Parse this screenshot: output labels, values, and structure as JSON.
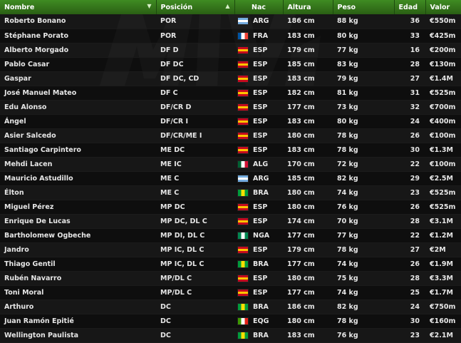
{
  "headers": {
    "name": "Nombre",
    "position": "Posición",
    "nation": "Nac",
    "height": "Altura",
    "weight": "Peso",
    "age": "Edad",
    "value": "Valor"
  },
  "flag_colors": {
    "ARG": [
      "#74acdf",
      "#ffffff",
      "#74acdf"
    ],
    "FRA": [
      "#0055a4",
      "#ffffff",
      "#ef4135"
    ],
    "ESP": [
      "#c60b1e",
      "#ffc400",
      "#c60b1e"
    ],
    "ALG": [
      "#006233",
      "#ffffff",
      "#d21034"
    ],
    "BRA": [
      "#009c3b",
      "#ffdf00",
      "#009c3b"
    ],
    "NGA": [
      "#008751",
      "#ffffff",
      "#008751"
    ],
    "EQG": [
      "#3e9a00",
      "#ffffff",
      "#e32118"
    ]
  },
  "players": [
    {
      "name": "Roberto Bonano",
      "position": "POR",
      "nation": "ARG",
      "height": "186 cm",
      "weight": "88 kg",
      "age": "36",
      "value": "€550m"
    },
    {
      "name": "Stéphane Porato",
      "position": "POR",
      "nation": "FRA",
      "height": "183 cm",
      "weight": "80 kg",
      "age": "33",
      "value": "€425m"
    },
    {
      "name": "Alberto Morgado",
      "position": "DF D",
      "nation": "ESP",
      "height": "179 cm",
      "weight": "77 kg",
      "age": "16",
      "value": "€200m"
    },
    {
      "name": "Pablo Casar",
      "position": "DF DC",
      "nation": "ESP",
      "height": "185 cm",
      "weight": "83 kg",
      "age": "28",
      "value": "€130m"
    },
    {
      "name": "Gaspar",
      "position": "DF DC, CD",
      "nation": "ESP",
      "height": "183 cm",
      "weight": "79 kg",
      "age": "27",
      "value": "€1.4M"
    },
    {
      "name": "José Manuel Mateo",
      "position": "DF C",
      "nation": "ESP",
      "height": "182 cm",
      "weight": "81 kg",
      "age": "31",
      "value": "€525m"
    },
    {
      "name": "Edu Alonso",
      "position": "DF/CR D",
      "nation": "ESP",
      "height": "177 cm",
      "weight": "73 kg",
      "age": "32",
      "value": "€700m"
    },
    {
      "name": "Ángel",
      "position": "DF/CR I",
      "nation": "ESP",
      "height": "183 cm",
      "weight": "80 kg",
      "age": "24",
      "value": "€400m"
    },
    {
      "name": "Asier Salcedo",
      "position": "DF/CR/ME I",
      "nation": "ESP",
      "height": "180 cm",
      "weight": "78 kg",
      "age": "26",
      "value": "€100m"
    },
    {
      "name": "Santiago Carpintero",
      "position": "ME DC",
      "nation": "ESP",
      "height": "183 cm",
      "weight": "78 kg",
      "age": "30",
      "value": "€1.3M"
    },
    {
      "name": "Mehdi Lacen",
      "position": "ME IC",
      "nation": "ALG",
      "height": "170 cm",
      "weight": "72 kg",
      "age": "22",
      "value": "€100m"
    },
    {
      "name": "Mauricio Astudillo",
      "position": "ME C",
      "nation": "ARG",
      "height": "185 cm",
      "weight": "82 kg",
      "age": "29",
      "value": "€2.5M"
    },
    {
      "name": "Élton",
      "position": "ME C",
      "nation": "BRA",
      "height": "180 cm",
      "weight": "74 kg",
      "age": "23",
      "value": "€525m"
    },
    {
      "name": "Miguel Pérez",
      "position": "MP DC",
      "nation": "ESP",
      "height": "180 cm",
      "weight": "76 kg",
      "age": "26",
      "value": "€525m"
    },
    {
      "name": "Enrique De Lucas",
      "position": "MP DC, DL C",
      "nation": "ESP",
      "height": "174 cm",
      "weight": "70 kg",
      "age": "28",
      "value": "€3.1M"
    },
    {
      "name": "Bartholomew Ogbeche",
      "position": "MP DI, DL C",
      "nation": "NGA",
      "height": "177 cm",
      "weight": "77 kg",
      "age": "22",
      "value": "€1.2M"
    },
    {
      "name": "Jandro",
      "position": "MP IC, DL C",
      "nation": "ESP",
      "height": "179 cm",
      "weight": "78 kg",
      "age": "27",
      "value": "€2M"
    },
    {
      "name": "Thiago Gentil",
      "position": "MP IC, DL C",
      "nation": "BRA",
      "height": "177 cm",
      "weight": "74 kg",
      "age": "26",
      "value": "€1.9M"
    },
    {
      "name": "Rubén Navarro",
      "position": "MP/DL C",
      "nation": "ESP",
      "height": "180 cm",
      "weight": "75 kg",
      "age": "28",
      "value": "€3.3M"
    },
    {
      "name": "Toni Moral",
      "position": "MP/DL C",
      "nation": "ESP",
      "height": "177 cm",
      "weight": "74 kg",
      "age": "25",
      "value": "€1.7M"
    },
    {
      "name": "Arthuro",
      "position": "DC",
      "nation": "BRA",
      "height": "186 cm",
      "weight": "82 kg",
      "age": "24",
      "value": "€750m"
    },
    {
      "name": "Juan Ramón Epitié",
      "position": "DC",
      "nation": "EQG",
      "height": "180 cm",
      "weight": "78 kg",
      "age": "30",
      "value": "€160m"
    },
    {
      "name": "Wellington Paulista",
      "position": "DC",
      "nation": "BRA",
      "height": "183 cm",
      "weight": "76 kg",
      "age": "23",
      "value": "€2.1M"
    }
  ]
}
